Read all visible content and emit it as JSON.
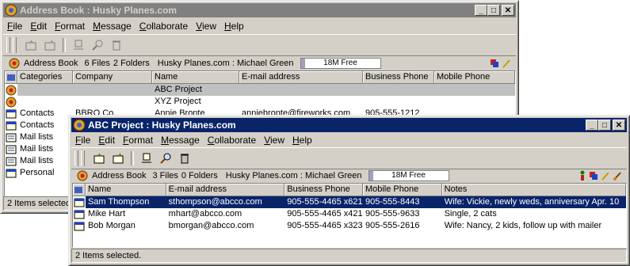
{
  "back_window": {
    "title": "Address Book : Husky Planes.com",
    "menu": [
      "File",
      "Edit",
      "Format",
      "Message",
      "Collaborate",
      "View",
      "Help"
    ],
    "info": {
      "label": "Address Book",
      "files": "6 Files",
      "folders": "2 Folders",
      "user": "Husky Planes.com : Michael Green",
      "free": "18M Free",
      "free_fraction": 0.05
    },
    "columns": [
      "Categories",
      "Company",
      "Name",
      "E-mail address",
      "Business Phone",
      "Mobile Phone"
    ],
    "rows": [
      {
        "icon": "person-icon",
        "category": "",
        "company": "",
        "name": "ABC Project",
        "email": "",
        "phone": "",
        "mobile": "",
        "state": "gray"
      },
      {
        "icon": "person-icon",
        "category": "",
        "company": "",
        "name": "XYZ Project",
        "email": "",
        "phone": "",
        "mobile": "",
        "state": ""
      },
      {
        "icon": "card-icon",
        "category": "Contacts",
        "company": "BBRO Co.",
        "name": "Annie Bronte",
        "email": "anniebronte@fireworks.com",
        "phone": "905-555-1212",
        "mobile": "",
        "state": ""
      },
      {
        "icon": "card-icon",
        "category": "Contacts",
        "company": "",
        "name": "",
        "email": "",
        "phone": "",
        "mobile": "",
        "state": ""
      },
      {
        "icon": "list-icon",
        "category": "Mail lists",
        "company": "",
        "name": "",
        "email": "",
        "phone": "",
        "mobile": "",
        "state": ""
      },
      {
        "icon": "list-icon",
        "category": "Mail lists",
        "company": "",
        "name": "",
        "email": "",
        "phone": "",
        "mobile": "",
        "state": ""
      },
      {
        "icon": "list-icon",
        "category": "Mail lists",
        "company": "",
        "name": "",
        "email": "",
        "phone": "",
        "mobile": "",
        "state": ""
      },
      {
        "icon": "card-icon",
        "category": "Personal",
        "company": "",
        "name": "",
        "email": "",
        "phone": "",
        "mobile": "",
        "state": ""
      }
    ],
    "status": "2 Items selected."
  },
  "front_window": {
    "title": "ABC Project : Husky Planes.com",
    "menu": [
      "File",
      "Edit",
      "Format",
      "Message",
      "Collaborate",
      "View",
      "Help"
    ],
    "info": {
      "label": "Address Book",
      "files": "3 Files",
      "folders": "0 Folders",
      "user": "Husky Planes.com : Michael Green",
      "free": "18M Free",
      "free_fraction": 0.05
    },
    "columns": [
      "Name",
      "E-mail address",
      "Business Phone",
      "Mobile Phone",
      "Notes"
    ],
    "rows": [
      {
        "name": "Sam Thompson",
        "email": "sthompson@abcco.com",
        "phone": "905-555-4465 x621",
        "mobile": "905-555-8443",
        "notes": "Wife: Vickie, newly weds, anniversary Apr. 10",
        "state": "sel"
      },
      {
        "name": "Mike Hart",
        "email": "mhart@abcco.com",
        "phone": "905-555-4465 x421",
        "mobile": "905-555-9633",
        "notes": "Single, 2 cats",
        "state": ""
      },
      {
        "name": "Bob Morgan",
        "email": "bmorgan@abcco.com",
        "phone": "905-555-4465 x323",
        "mobile": "905-555-2616",
        "notes": "Wife: Nancy, 2 kids, follow up with mailer",
        "state": ""
      }
    ],
    "status": "2 Items selected."
  }
}
